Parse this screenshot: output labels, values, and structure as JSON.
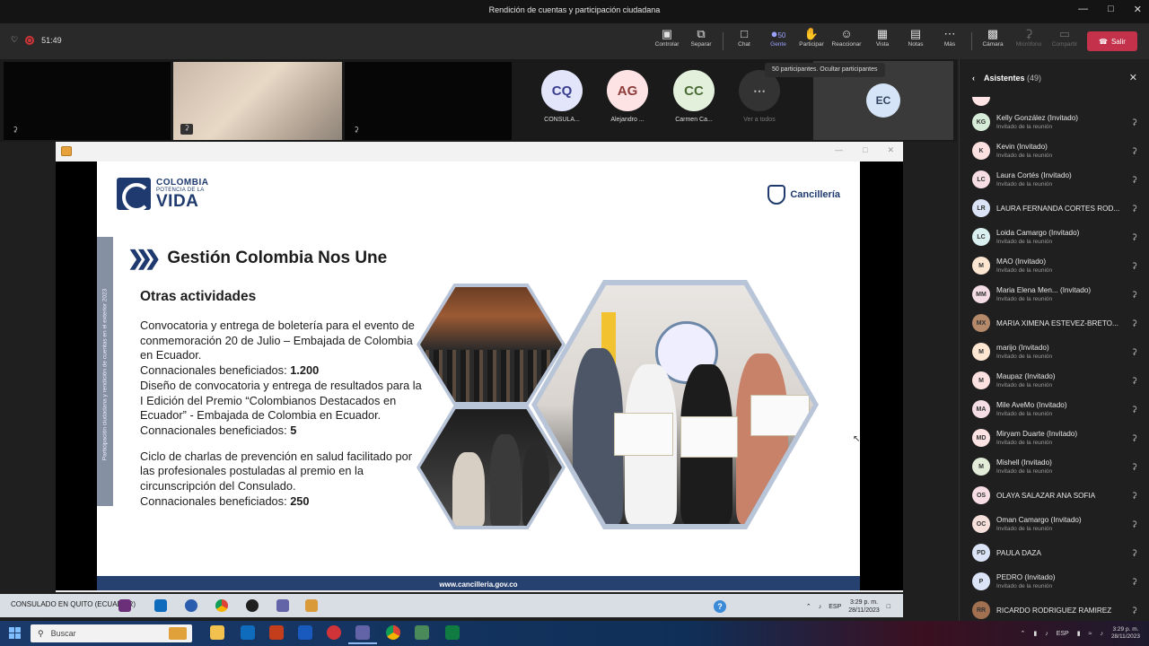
{
  "window": {
    "title": "Rendición de cuentas y participación ciudadana"
  },
  "meeting": {
    "timer": "51:49"
  },
  "toolbar": {
    "buttons": [
      {
        "label": "Controlar",
        "icon": "control-icon"
      },
      {
        "label": "Separar",
        "icon": "pop-out-icon"
      },
      {
        "label": "Chat",
        "icon": "chat-icon"
      },
      {
        "label": "Gente",
        "icon": "people-icon",
        "badge": "50",
        "active": true
      },
      {
        "label": "Participar",
        "icon": "raise-hand-icon"
      },
      {
        "label": "Reaccionar",
        "icon": "reaction-icon"
      },
      {
        "label": "Vista",
        "icon": "view-icon"
      },
      {
        "label": "Notas",
        "icon": "notes-icon"
      },
      {
        "label": "Más",
        "icon": "more-icon"
      },
      {
        "label": "Cámara",
        "icon": "camera-off-icon"
      },
      {
        "label": "Micrófono",
        "icon": "mic-icon",
        "disabled": true
      },
      {
        "label": "Compartir",
        "icon": "share-icon",
        "disabled": true
      }
    ],
    "leave_label": "Salir",
    "tooltip": "50 participantes. Ocultar participantes"
  },
  "video_strip": {
    "participants": [
      {
        "initials": "CQ",
        "name": "CONSULA...",
        "bg": "#e3e5fb",
        "fg": "#3b3e8e"
      },
      {
        "initials": "AG",
        "name": "Alejandro ...",
        "bg": "#fde3e3",
        "fg": "#8e3b3b"
      },
      {
        "initials": "CC",
        "name": "Carmen Ca...",
        "bg": "#e3f0dc",
        "fg": "#4b6b35"
      }
    ],
    "see_all_label": "Ver a todos",
    "spotlight_initials": "EC"
  },
  "slide": {
    "logo_line1": "COLOMBIA",
    "logo_line2": "POTENCIA DE LA",
    "logo_line3": "VIDA",
    "cancilleria": "Cancillería",
    "side_tab": "Participación ciudadana y rendición de cuentas en el exterior 2023",
    "heading": "Gestión Colombia Nos Une",
    "subheading": "Otras actividades",
    "activity1_text": "Convocatoria y entrega de boletería para el evento de conmemoración 20 de Julio – Embajada de Colombia en Ecuador.",
    "activity1_label": "Connacionales beneficiados: ",
    "activity1_count": "1.200",
    "activity2_text": "Diseño de convocatoria y entrega de resultados para la I Edición del Premio “Colombianos Destacados en Ecuador” - Embajada de Colombia en Ecuador.",
    "activity2_label": "Connacionales beneficiados: ",
    "activity2_count": "5",
    "activity3_text": "Ciclo de charlas de prevención en salud facilitado por las profesionales postuladas al premio en la circunscripción del Consulado.",
    "activity3_label": "Connacionales beneficiados: ",
    "activity3_count": "250",
    "footer_url": "www.cancilleria.gov.co"
  },
  "inner_taskbar": {
    "label": "CONSULADO EN QUITO (ECUADOR)",
    "lang": "ESP",
    "time": "3:29 p. m.",
    "date": "28/11/2023"
  },
  "taskbar": {
    "search_placeholder": "Buscar",
    "lang": "ESP",
    "time": "3:29 p. m.",
    "date": "28/11/2023"
  },
  "attendees_panel": {
    "title": "Asistentes",
    "count": "(49)",
    "role_invited": "Invitado de la reunión",
    "people": [
      {
        "initials": "KG",
        "name": "Kelly González (Invitado)",
        "sub": true,
        "bg": "#d6ecd8"
      },
      {
        "initials": "K",
        "name": "Kevin (Invitado)",
        "sub": true,
        "bg": "#fde1e1"
      },
      {
        "initials": "LC",
        "name": "Laura Cortés (Invitado)",
        "sub": true,
        "bg": "#f6dee4"
      },
      {
        "initials": "LR",
        "name": "LAURA FERNANDA CORTES ROD...",
        "sub": false,
        "bg": "#dbe4f7"
      },
      {
        "initials": "LC",
        "name": "Loida Camargo (Invitado)",
        "sub": true,
        "bg": "#d9eff0"
      },
      {
        "initials": "M",
        "name": "MAO (Invitado)",
        "sub": true,
        "bg": "#fde7d2"
      },
      {
        "initials": "MM",
        "name": "Maria Elena Men... (Invitado)",
        "sub": true,
        "bg": "#f5dde6"
      },
      {
        "initials": "MX",
        "name": "MARIA XIMENA ESTEVEZ-BRETO...",
        "sub": false,
        "bg": "#b48a6a"
      },
      {
        "initials": "M",
        "name": "marijo (Invitado)",
        "sub": true,
        "bg": "#fde7d2"
      },
      {
        "initials": "M",
        "name": "Maupaz (Invitado)",
        "sub": true,
        "bg": "#fde1e1"
      },
      {
        "initials": "MA",
        "name": "Mile AveMo (Invitado)",
        "sub": true,
        "bg": "#f5dde6"
      },
      {
        "initials": "MD",
        "name": "Miryam Duarte (Invitado)",
        "sub": true,
        "bg": "#fde3e3"
      },
      {
        "initials": "M",
        "name": "Mishell (Invitado)",
        "sub": true,
        "bg": "#e2ecd9"
      },
      {
        "initials": "OS",
        "name": "OLAYA SALAZAR ANA SOFIA",
        "sub": false,
        "bg": "#f6dee4"
      },
      {
        "initials": "OC",
        "name": "Oman Camargo (Invitado)",
        "sub": true,
        "bg": "#f6e0dc"
      },
      {
        "initials": "PD",
        "name": "PAULA DAZA",
        "sub": false,
        "bg": "#dbe4f7"
      },
      {
        "initials": "P",
        "name": "PEDRO (Invitado)",
        "sub": true,
        "bg": "#dbe4f7"
      },
      {
        "initials": "RR",
        "name": "RICARDO RODRIGUEZ RAMIREZ",
        "sub": false,
        "bg": "#a07050"
      }
    ]
  }
}
